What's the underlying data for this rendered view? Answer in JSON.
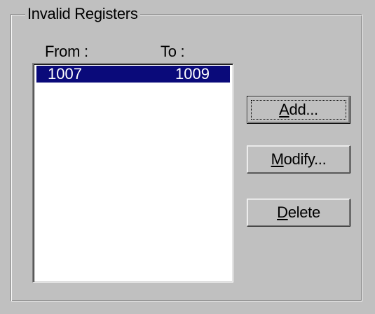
{
  "group": {
    "title": "Invalid Registers"
  },
  "list": {
    "columns": {
      "from": "From :",
      "to": "To :"
    },
    "rows": [
      {
        "from": "1007",
        "to": "1009",
        "selected": true
      }
    ],
    "selection_color": "#0a0a7a"
  },
  "buttons": {
    "add": {
      "mnemonic": "A",
      "rest": "dd..."
    },
    "modify": {
      "mnemonic": "M",
      "rest": "odify..."
    },
    "delete": {
      "mnemonic": "D",
      "rest": "elete"
    }
  }
}
